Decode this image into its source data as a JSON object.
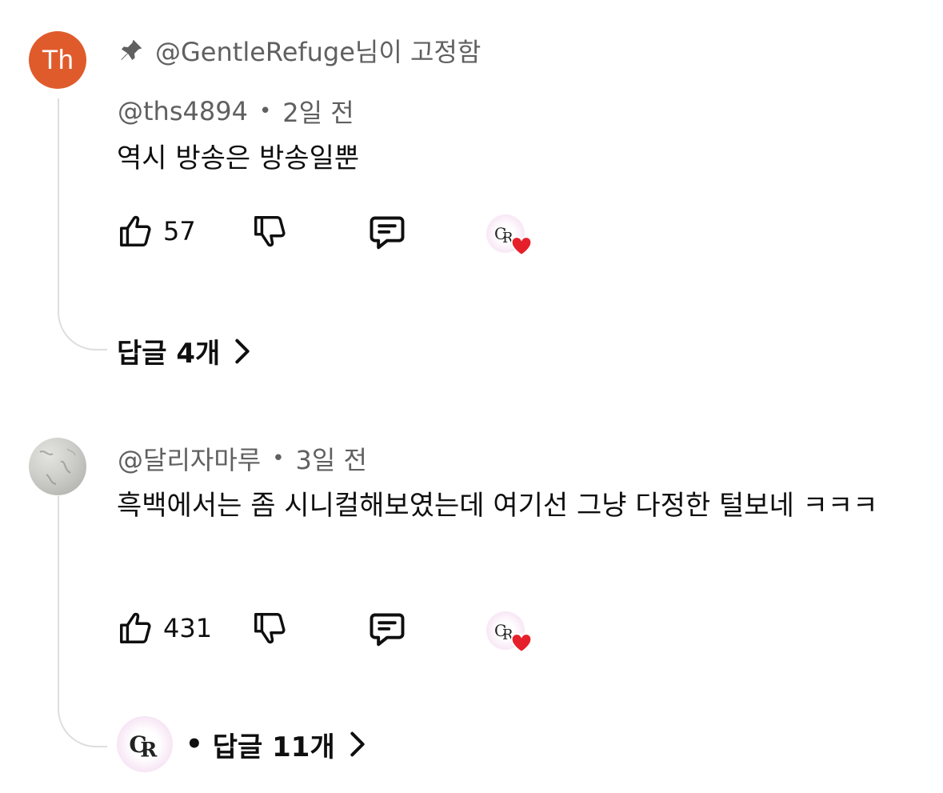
{
  "comments": [
    {
      "pinned_label": "@GentleRefuge님이 고정함",
      "avatar_initials": "Th",
      "author": "@ths4894",
      "time": "2일 전",
      "text": "역시 방송은 방송일뿐",
      "likes": "57",
      "replies_label": "답글 4개"
    },
    {
      "author": "@달리자마루",
      "time": "3일 전",
      "text": "흑백에서는 좀 시니컬해보였는데 여기선 그냥 다정한 털보네 ㅋㅋㅋ",
      "likes": "431",
      "replies_label": "답글 11개"
    }
  ],
  "colors": {
    "avatar_th": "#e05b2b",
    "heart": "#e5202b",
    "secondary_text": "#606060",
    "thread_line": "#dedede"
  },
  "icons": [
    "pin-icon",
    "thumbs-up-icon",
    "thumbs-down-icon",
    "reply-comment-icon",
    "creator-heart-icon",
    "chevron-right-icon"
  ]
}
